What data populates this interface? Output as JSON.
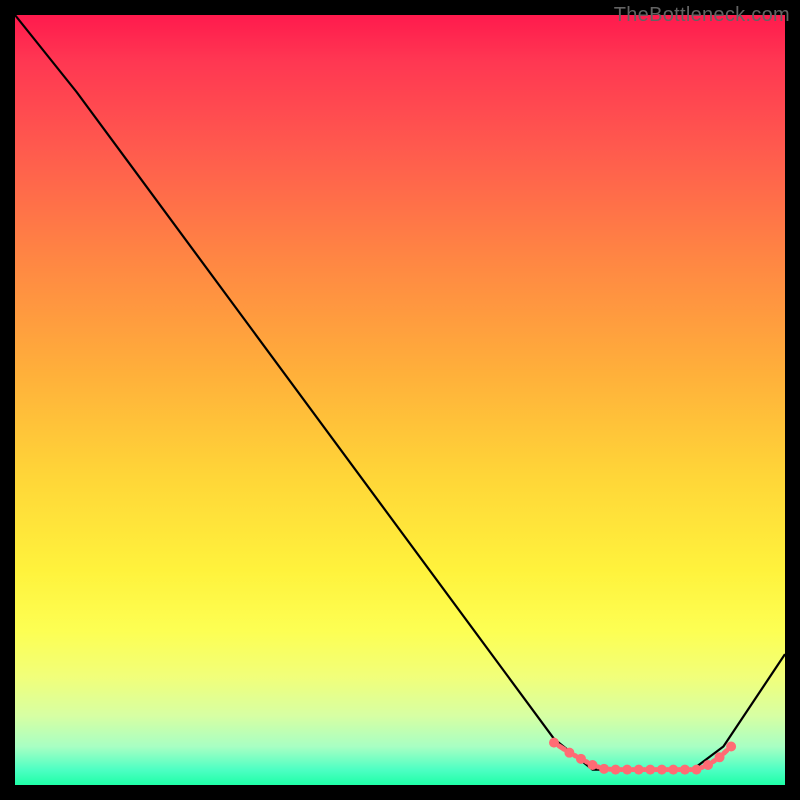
{
  "watermark": "TheBottleneck.com",
  "chart_data": {
    "type": "line",
    "title": "",
    "xlabel": "",
    "ylabel": "",
    "xlim": [
      0,
      100
    ],
    "ylim": [
      0,
      100
    ],
    "grid": false,
    "legend": false,
    "background_gradient": {
      "direction": "vertical",
      "stops": [
        {
          "pos": 0,
          "color": "#ff1a4d"
        },
        {
          "pos": 50,
          "color": "#ffd638"
        },
        {
          "pos": 80,
          "color": "#fdff53"
        },
        {
          "pos": 100,
          "color": "#1effa7"
        }
      ]
    },
    "series": [
      {
        "name": "bottleneck-curve",
        "type": "line",
        "x": [
          0,
          8,
          70,
          75,
          88,
          92,
          100
        ],
        "y": [
          100,
          90,
          6,
          2,
          2,
          5,
          17
        ]
      }
    ],
    "markers": {
      "name": "highlighted-points",
      "color": "#ff6b74",
      "x": [
        70,
        72,
        73.5,
        75,
        76.5,
        78,
        79.5,
        81,
        82.5,
        84,
        85.5,
        87,
        88.5,
        90,
        91.5,
        93
      ],
      "y": [
        5.5,
        4.2,
        3.4,
        2.6,
        2.1,
        2.0,
        2.0,
        2.0,
        2.0,
        2.0,
        2.0,
        2.0,
        2.0,
        2.6,
        3.6,
        5.0
      ]
    }
  }
}
